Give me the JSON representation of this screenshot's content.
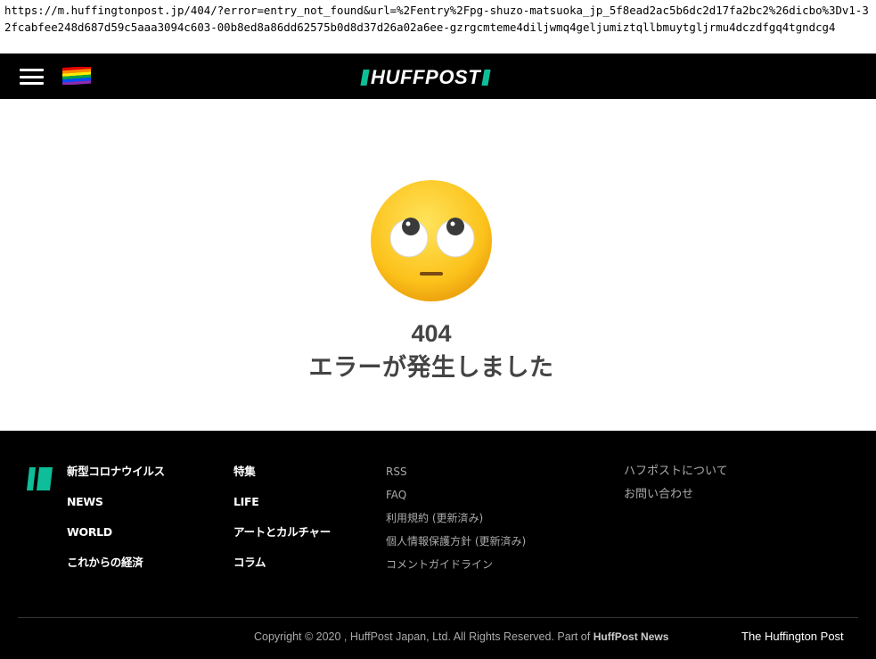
{
  "browser": {
    "url": "https://m.huffingtonpost.jp/404/?error=entry_not_found&url=%2Fentry%2Fpg-shuzo-matsuoka_jp_5f8ead2ac5b6dc2d17fa2bc2%26dicbo%3Dv1-32fcabfee248d687d59c5aaa3094c603-00b8ed8a86dd62575b0d8d37d26a02a6ee-gzrgcmteme4diljwmq4geljumiztqllbmuytgljrmu4dczdfgq4tgndcg4"
  },
  "header": {
    "logo_text": "HUFFPOST",
    "menu_icon": "hamburger-menu-icon",
    "flag_icon": "rainbow-pride-flag-icon",
    "background": "#000000",
    "accent": "#0dbe98"
  },
  "error": {
    "emoji": "face-with-rolling-eyes-icon",
    "code": "404",
    "message": "エラーが発生しました"
  },
  "footer": {
    "col1": [
      "新型コロナウイルス",
      "NEWS",
      "WORLD",
      "これからの経済"
    ],
    "col2": [
      "特集",
      "LIFE",
      "アートとカルチャー",
      "コラム"
    ],
    "col3": [
      "RSS",
      "FAQ",
      "利用規約 (更新済み)",
      "個人情報保護方針 (更新済み)",
      "コメントガイドライン"
    ],
    "col4": [
      "ハフポストについて",
      "お問い合わせ"
    ],
    "copyright_prefix": "Copyright © 2020 , HuffPost Japan, Ltd. All Rights Reserved. Part of",
    "copyright_brand": "HuffPost News",
    "corp_link": "The Huffington Post"
  }
}
